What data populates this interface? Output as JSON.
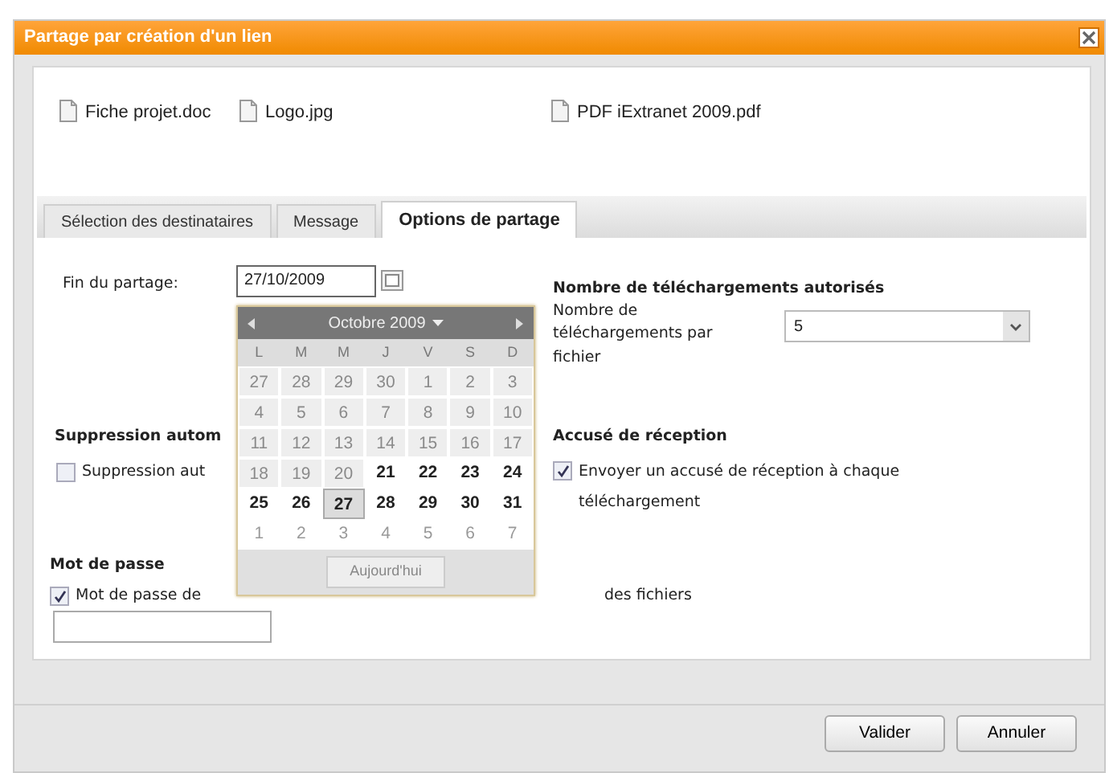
{
  "dialog": {
    "title": "Partage par création d'un lien"
  },
  "files": [
    "Fiche projet.doc",
    "Logo.jpg",
    "PDF iExtranet 2009.pdf"
  ],
  "tabs": [
    {
      "label": "Sélection des destinataires",
      "selected": false
    },
    {
      "label": "Message",
      "selected": false
    },
    {
      "label": "Options de partage",
      "selected": true
    }
  ],
  "end_date": {
    "label": "Fin du partage:",
    "value": "27/10/2009"
  },
  "calendar": {
    "month": "Octobre 2009",
    "weekdays": [
      "L",
      "M",
      "M",
      "J",
      "V",
      "S",
      "D"
    ],
    "days": [
      {
        "label": "27",
        "kind": "disabled",
        "selected": false
      },
      {
        "label": "28",
        "kind": "disabled",
        "selected": false
      },
      {
        "label": "29",
        "kind": "disabled",
        "selected": false
      },
      {
        "label": "30",
        "kind": "disabled",
        "selected": false
      },
      {
        "label": "1",
        "kind": "disabled",
        "selected": false
      },
      {
        "label": "2",
        "kind": "disabled",
        "selected": false
      },
      {
        "label": "3",
        "kind": "disabled",
        "selected": false
      },
      {
        "label": "4",
        "kind": "disabled",
        "selected": false
      },
      {
        "label": "5",
        "kind": "disabled",
        "selected": false
      },
      {
        "label": "6",
        "kind": "disabled",
        "selected": false
      },
      {
        "label": "7",
        "kind": "disabled",
        "selected": false
      },
      {
        "label": "8",
        "kind": "disabled",
        "selected": false
      },
      {
        "label": "9",
        "kind": "disabled",
        "selected": false
      },
      {
        "label": "10",
        "kind": "disabled",
        "selected": false
      },
      {
        "label": "11",
        "kind": "disabled",
        "selected": false
      },
      {
        "label": "12",
        "kind": "disabled",
        "selected": false
      },
      {
        "label": "13",
        "kind": "disabled",
        "selected": false
      },
      {
        "label": "14",
        "kind": "disabled",
        "selected": false
      },
      {
        "label": "15",
        "kind": "disabled",
        "selected": false
      },
      {
        "label": "16",
        "kind": "disabled",
        "selected": false
      },
      {
        "label": "17",
        "kind": "disabled",
        "selected": false
      },
      {
        "label": "18",
        "kind": "disabled",
        "selected": false
      },
      {
        "label": "19",
        "kind": "disabled",
        "selected": false
      },
      {
        "label": "20",
        "kind": "disabled",
        "selected": false
      },
      {
        "label": "21",
        "kind": "normal",
        "selected": false
      },
      {
        "label": "22",
        "kind": "normal",
        "selected": false
      },
      {
        "label": "23",
        "kind": "normal",
        "selected": false
      },
      {
        "label": "24",
        "kind": "normal",
        "selected": false
      },
      {
        "label": "25",
        "kind": "normal",
        "selected": false
      },
      {
        "label": "26",
        "kind": "normal",
        "selected": false
      },
      {
        "label": "27",
        "kind": "normal",
        "selected": true
      },
      {
        "label": "28",
        "kind": "normal",
        "selected": false
      },
      {
        "label": "29",
        "kind": "normal",
        "selected": false
      },
      {
        "label": "30",
        "kind": "normal",
        "selected": false
      },
      {
        "label": "31",
        "kind": "normal",
        "selected": false
      },
      {
        "label": "1",
        "kind": "other",
        "selected": false
      },
      {
        "label": "2",
        "kind": "other",
        "selected": false
      },
      {
        "label": "3",
        "kind": "other",
        "selected": false
      },
      {
        "label": "4",
        "kind": "other",
        "selected": false
      },
      {
        "label": "5",
        "kind": "other",
        "selected": false
      },
      {
        "label": "6",
        "kind": "other",
        "selected": false
      },
      {
        "label": "7",
        "kind": "other",
        "selected": false
      }
    ],
    "today_button": "Aujourd'hui"
  },
  "downloads": {
    "heading": "Nombre de téléchargements autorisés",
    "label": "Nombre de téléchargements par fichier",
    "value": "5"
  },
  "auto_delete": {
    "heading": "Suppression autom",
    "checkbox": {
      "label": "Suppression aut",
      "checked": false
    }
  },
  "receipt": {
    "heading": "Accusé de réception",
    "checkbox": {
      "label": "Envoyer un accusé de réception à chaque téléchargement",
      "checked": true
    }
  },
  "password": {
    "heading": "Mot de passe",
    "checkbox": {
      "label": "Mot de passe de",
      "label_after": "des fichiers",
      "checked": true
    }
  },
  "buttons": [
    "Valider",
    "Annuler"
  ]
}
